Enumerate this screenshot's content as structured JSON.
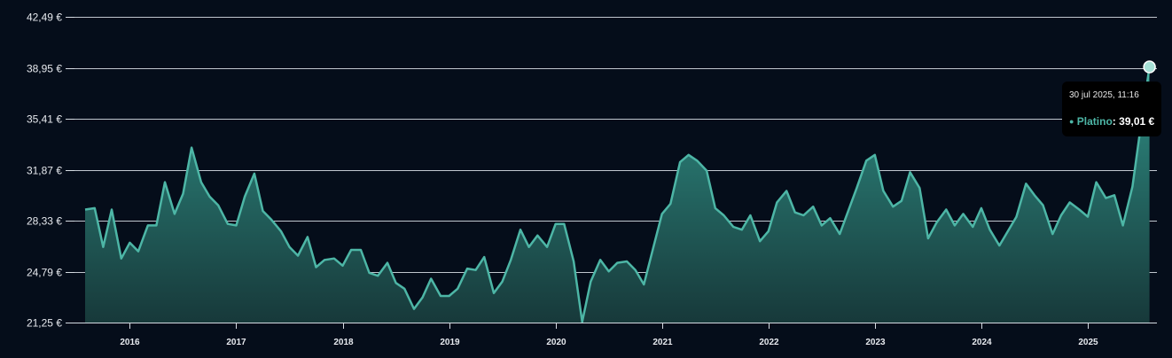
{
  "chart_data": {
    "type": "area",
    "title": "",
    "xlabel": "",
    "ylabel": "",
    "currency_suffix": " €",
    "y_ticks": [
      "21,25",
      "24,79",
      "28,33",
      "31,87",
      "35,41",
      "38,95",
      "42,49"
    ],
    "ylim": [
      21.25,
      42.49
    ],
    "x_tick_labels": [
      "2016",
      "2017",
      "2018",
      "2019",
      "2020",
      "2021",
      "2022",
      "2023",
      "2024",
      "2025"
    ],
    "xlim": [
      2015.58,
      2025.65
    ],
    "grid": true,
    "colors": {
      "line": "#4db6a6",
      "fill_top": "#2f8f85",
      "fill_bottom": "#17393a",
      "grid": "#d5dbe2",
      "background": "#050d1a"
    },
    "series": [
      {
        "name": "Platino",
        "x": [
          2015.58,
          2015.67,
          2015.75,
          2015.83,
          2015.92,
          2016.0,
          2016.08,
          2016.17,
          2016.25,
          2016.33,
          2016.42,
          2016.5,
          2016.58,
          2016.67,
          2016.75,
          2016.83,
          2016.92,
          2017.0,
          2017.08,
          2017.17,
          2017.25,
          2017.33,
          2017.42,
          2017.5,
          2017.58,
          2017.67,
          2017.75,
          2017.83,
          2017.92,
          2018.0,
          2018.08,
          2018.17,
          2018.25,
          2018.33,
          2018.42,
          2018.5,
          2018.58,
          2018.67,
          2018.75,
          2018.83,
          2018.92,
          2019.0,
          2019.08,
          2019.17,
          2019.25,
          2019.33,
          2019.42,
          2019.5,
          2019.58,
          2019.67,
          2019.75,
          2019.83,
          2019.92,
          2020.0,
          2020.08,
          2020.17,
          2020.25,
          2020.33,
          2020.42,
          2020.5,
          2020.58,
          2020.67,
          2020.75,
          2020.83,
          2020.92,
          2021.0,
          2021.08,
          2021.17,
          2021.25,
          2021.33,
          2021.42,
          2021.5,
          2021.58,
          2021.67,
          2021.75,
          2021.83,
          2021.92,
          2022.0,
          2022.08,
          2022.17,
          2022.25,
          2022.33,
          2022.42,
          2022.5,
          2022.58,
          2022.67,
          2022.75,
          2022.83,
          2022.92,
          2023.0,
          2023.08,
          2023.17,
          2023.25,
          2023.33,
          2023.42,
          2023.5,
          2023.58,
          2023.67,
          2023.75,
          2023.83,
          2023.92,
          2024.0,
          2024.08,
          2024.17,
          2024.25,
          2024.33,
          2024.42,
          2024.5,
          2024.58,
          2024.67,
          2024.75,
          2024.83,
          2024.92,
          2025.0,
          2025.08,
          2025.17,
          2025.25,
          2025.33,
          2025.42,
          2025.5,
          2025.58
        ],
        "y": [
          29.1,
          29.2,
          26.5,
          29.1,
          25.7,
          26.8,
          26.2,
          28.0,
          28.0,
          31.0,
          28.8,
          30.2,
          33.4,
          31.0,
          30.0,
          29.4,
          28.1,
          28.0,
          30.0,
          31.6,
          29.0,
          28.4,
          27.6,
          26.5,
          25.9,
          27.2,
          25.1,
          25.6,
          25.7,
          25.2,
          26.3,
          26.3,
          24.7,
          24.5,
          25.4,
          24.0,
          23.6,
          22.2,
          23.0,
          24.3,
          23.1,
          23.1,
          23.6,
          25.0,
          24.9,
          25.8,
          23.3,
          24.1,
          25.6,
          27.7,
          26.5,
          27.3,
          26.5,
          28.1,
          28.1,
          25.5,
          21.3,
          24.1,
          25.6,
          24.8,
          25.4,
          25.5,
          24.9,
          23.9,
          26.5,
          28.8,
          29.5,
          32.4,
          32.9,
          32.5,
          31.8,
          29.2,
          28.7,
          27.9,
          27.7,
          28.7,
          26.9,
          27.6,
          29.6,
          30.4,
          28.9,
          28.7,
          29.3,
          28.0,
          28.5,
          27.4,
          29.0,
          30.6,
          32.5,
          32.9,
          30.4,
          29.3,
          29.7,
          31.7,
          30.6,
          27.1,
          28.2,
          29.1,
          28.0,
          28.8,
          27.9,
          29.2,
          27.7,
          26.6,
          27.6,
          28.6,
          30.9,
          30.1,
          29.4,
          27.4,
          28.7,
          29.6,
          29.1,
          28.6,
          31.0,
          29.9,
          30.1,
          28.0,
          30.7,
          35.0,
          39.01
        ]
      }
    ],
    "tooltip": {
      "date": "30 jul 2025, 11:16",
      "series": "Platino",
      "value": "39,01 €"
    }
  }
}
